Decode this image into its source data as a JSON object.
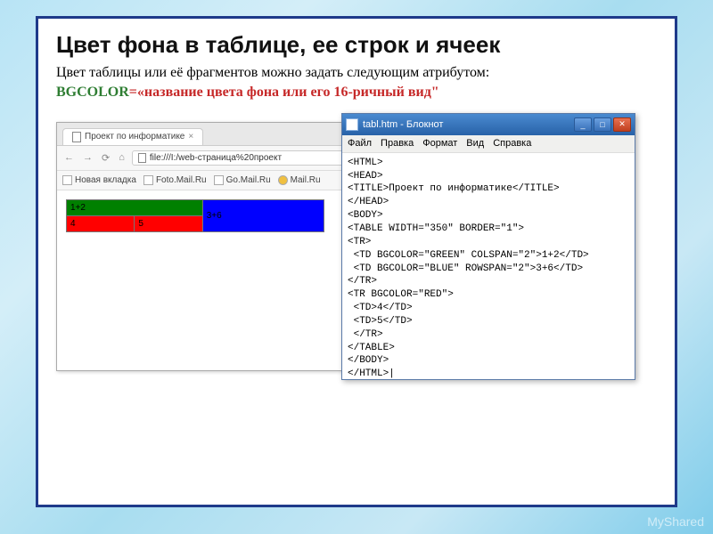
{
  "title": "Цвет фона в таблице, ее строк и ячеек",
  "description": "Цвет таблицы или её фрагментов можно задать следующим атрибутом:",
  "attr": {
    "name": "BGCOLOR",
    "eq": "=",
    "value": "«название цвета фона или его 16-ричный вид\""
  },
  "browser": {
    "tab_title": "Проект по информатике",
    "nav_back": "←",
    "nav_fwd": "→",
    "reload": "⟳",
    "home": "⌂",
    "url": "file:///I:/web-страница%20проект",
    "bookmarks": [
      "Новая вкладка",
      "Foto.Mail.Ru",
      "Go.Mail.Ru",
      "Mail.Ru"
    ],
    "table": {
      "cell_12": "1+2",
      "cell_36": "3+6",
      "cell_4": "4",
      "cell_5": "5"
    }
  },
  "notepad": {
    "title": "tabl.htm - Блокнот",
    "menu": [
      "Файл",
      "Правка",
      "Формат",
      "Вид",
      "Справка"
    ],
    "btn_min": "_",
    "btn_max": "□",
    "btn_close": "✕",
    "code": "<HTML>\n<HEAD>\n<TITLE>Проект по информатике</TITLE>\n</HEAD>\n<BODY>\n<TABLE WIDTH=\"350\" BORDER=\"1\">\n<TR>\n <TD BGCOLOR=\"GREEN\" COLSPAN=\"2\">1+2</TD>\n <TD BGCOLOR=\"BLUE\" ROWSPAN=\"2\">3+6</TD>\n</TR>\n<TR BGCOLOR=\"RED\">\n <TD>4</TD>\n <TD>5</TD>\n </TR>\n</TABLE>\n</BODY>\n</HTML>|"
  },
  "watermark": "MyShared"
}
